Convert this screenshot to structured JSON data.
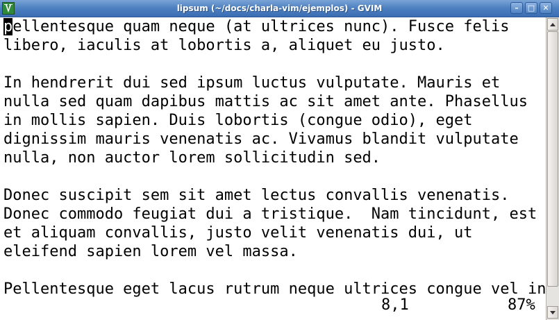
{
  "window": {
    "title": "lipsum (~/docs/charla-vim/ejemplos) - GVIM",
    "buttons": {
      "minimize": "–",
      "maximize": "□",
      "close": "✕"
    }
  },
  "editor": {
    "cursor_char": "p",
    "first_line_rest": "ellentesque quam neque (at ultrices nunc). Fusce felis",
    "lines": [
      "libero, iaculis at lobortis a, aliquet eu justo.",
      "",
      "In hendrerit dui sed ipsum luctus vulputate. Mauris et",
      "nulla sed quam dapibus mattis ac sit amet ante. Phasellus",
      "in mollis sapien. Duis lobortis (congue odio), eget",
      "dignissim mauris venenatis ac. Vivamus blandit vulputate",
      "nulla, non auctor lorem sollicitudin sed.",
      "",
      "Donec suscipit sem sit amet lectus convallis venenatis.",
      "Donec commodo feugiat dui a tristique.  Nam tincidunt, est",
      "et aliquam convallis, justo velit venenatis dui, ut",
      "eleifend sapien lorem vel massa.",
      "",
      "Pellentesque eget lacus rutrum neque ultrices congue vel in"
    ]
  },
  "ruler": {
    "position": "8,1",
    "percent": "87%"
  },
  "scrollbar": {
    "position_percent": 87
  },
  "icons": {
    "app": "gvim-app-icon",
    "scroll_up": "arrow-up-icon",
    "scroll_down": "arrow-down-icon"
  },
  "colors": {
    "titlebar": "#4c7fc0",
    "text": "#000000",
    "background": "#ffffff",
    "cursor": "#000000"
  }
}
